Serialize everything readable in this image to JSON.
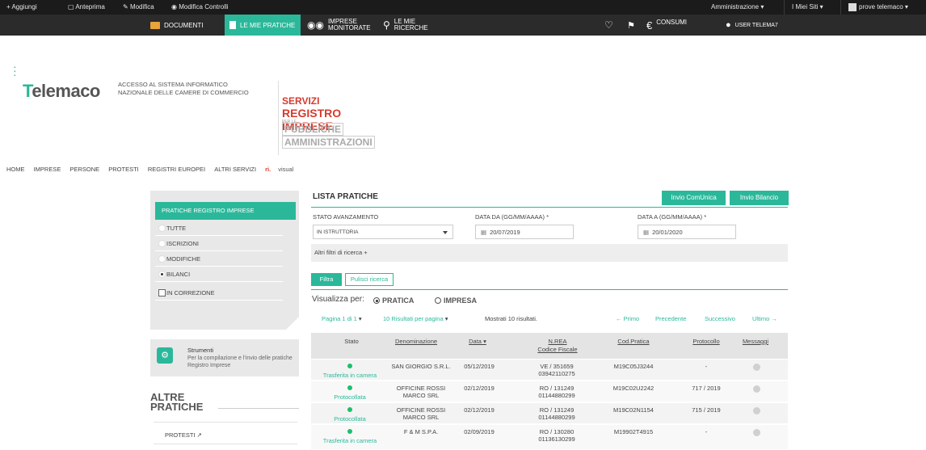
{
  "adminbar": {
    "aggiungi": "+ Aggiungi",
    "anteprima": "Anteprima",
    "modifica": "Modifica",
    "modifica_controlli": "Modifica Controlli",
    "amministrazione": "Amministrazione",
    "miei_siti": "I Miei Siti",
    "user": "prove telemaco"
  },
  "nav": {
    "documenti": "DOCUMENTI",
    "le_mie_pratiche": "LE MIE PRATICHE",
    "imprese_1": "IMPRESE",
    "imprese_2": "MONITORATE",
    "ricerche_1": "LE MIE",
    "ricerche_2": "RICERCHE",
    "consumi": "CONSUMI",
    "user": "USER TELEMA7"
  },
  "header": {
    "logo_pre": "",
    "logo_t": "T",
    "logo_rest": "elemaco",
    "tagline_1": "ACCESSO AL SISTEMA INFORMATICO",
    "tagline_2": "NAZIONALE DELLE CAMERE DI COMMERCIO",
    "servizi_1": "SERVIZI",
    "servizi_2": "REGISTRO IMPRESE",
    "servizi_3": "PER LE",
    "servizi_4": "PUBBLICHE",
    "servizi_5": "AMMINISTRAZIONI"
  },
  "menu": {
    "home": "HOME",
    "imprese": "IMPRESE",
    "persone": "PERSONE",
    "protesti": "PROTESTI",
    "registri": "REGISTRI EUROPEI",
    "altri": "ALTRI SERVIZI",
    "ri": "ri.",
    "visual": "visual"
  },
  "leftpanel": {
    "title": "PRATICHE REGISTRO IMPRESE",
    "items": [
      "TUTTE",
      "ISCRIZIONI",
      "MODIFICHE",
      "BILANCI",
      "IN CORREZIONE"
    ]
  },
  "strumenti": {
    "title": "Strumenti",
    "desc": "Per la compilazione e l'invio delle pratiche Registro Imprese"
  },
  "altre": {
    "line1": "ALTRE",
    "line2": "PRATICHE",
    "protesti": "PROTESTI"
  },
  "content": {
    "title": "LISTA PRATICHE",
    "btn_comunica": "Invio ComUnica",
    "btn_bilancio": "Invio Bilancio",
    "label_stato": "STATO AVANZAMENTO",
    "label_da": "DATA DA (GG/MM/AAAA) *",
    "label_a": "DATA A (GG/MM/AAAA) *",
    "stato_value": "IN ISTRUTTORIA",
    "data_da": "20/07/2019",
    "data_a": "20/01/2020",
    "altri_filtri": "Altri filtri di ricerca +",
    "btn_filtra": "Filtra",
    "btn_pulisci": "Pulisci ricerca",
    "visualizza": "Visualizza per:",
    "opt_pratica": "PRATICA",
    "opt_impresa": "IMPRESA",
    "pagina": "Pagina 1 di 1",
    "risultati": "10 Risultati per pagina",
    "mostrati": "Mostrati 10 risultati.",
    "primo": "← Primo",
    "precedente": "Precedente",
    "successivo": "Successivo",
    "ultimo": "Ultimo →"
  },
  "table": {
    "headers": {
      "stato": "Stato",
      "denominazione": "Denominazione",
      "data": "Data ▾",
      "nrea_1": "N.REA",
      "nrea_2": "Codice Fiscale",
      "cod": "Cod.Pratica",
      "protocollo": "Protocollo",
      "messaggi": "Messaggi"
    },
    "rows": [
      {
        "stato": "Trasferita in camera",
        "den1": "SAN GIORGIO S.R.L.",
        "den2": "",
        "data": "05/12/2019",
        "rea": "VE / 351659",
        "cf": "03942110275",
        "cod": "M19C05J3244",
        "prot": "-"
      },
      {
        "stato": "Protocollata",
        "den1": "OFFICINE ROSSI",
        "den2": "MARCO SRL",
        "data": "02/12/2019",
        "rea": "RO / 131249",
        "cf": "01144880299",
        "cod": "M19C02U2242",
        "prot": "717 / 2019"
      },
      {
        "stato": "Protocollata",
        "den1": "OFFICINE ROSSI",
        "den2": "MARCO SRL",
        "data": "02/12/2019",
        "rea": "RO / 131249",
        "cf": "01144880299",
        "cod": "M19C02N1154",
        "prot": "715 / 2019"
      },
      {
        "stato": "Trasferita in camera",
        "den1": "F & M S.P.A.",
        "den2": "",
        "data": "02/09/2019",
        "rea": "RO / 130280",
        "cf": "01136130299",
        "cod": "M19902T4915",
        "prot": "-"
      }
    ]
  }
}
